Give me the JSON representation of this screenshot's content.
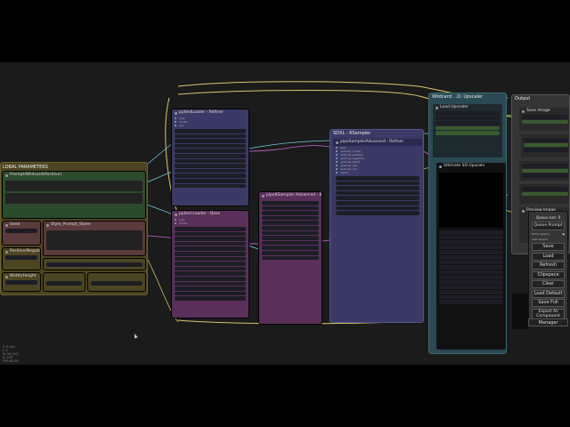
{
  "groups": {
    "global": {
      "title": "LOBAL PARAMETERS"
    },
    "sdxl": {
      "title": "SDXL - KSampler"
    },
    "detailer": {
      "title": "Wildcard: ..D: Upscaler"
    },
    "output": {
      "title": "Output"
    }
  },
  "nodes": {
    "prompt_pos": {
      "title": "Prompt/Wildcard(Positive)"
    },
    "prompt_neg": {
      "title": "Prompt Negative"
    },
    "seed": {
      "title": "Seed"
    },
    "pos_neg": {
      "title": "Positive/Negative"
    },
    "width_height": {
      "title": "Width/Height"
    },
    "style": {
      "title": "Style_Prompt_Styler"
    },
    "sampler_a": {
      "title": "ppliedLoader - Refiner"
    },
    "sampler_b": {
      "title": "pplied Loader - Base"
    },
    "ksampler_main": {
      "title": "pipeSamplerAdvanced - Refiner"
    },
    "pipe_ksampler": {
      "title": "pipeKSampler Advanced - Base"
    },
    "load_upscale": {
      "title": "Load Upscaler"
    },
    "ultimate_upscale": {
      "title": "Ultimate SD Upscale"
    },
    "image_preview": {
      "title": "Preview Image"
    },
    "out_a": {
      "title": "Save Image"
    }
  },
  "menu": {
    "queue_size_label": "Queue size: 0",
    "queue_prompt": "Queue Prompt",
    "extra_options": "Extra options",
    "auto_queue": "Auto Queue",
    "buttons": {
      "save": "Save",
      "load": "Load",
      "refresh": "Refresh",
      "clipspace": "Clipspace",
      "clear": "Clear",
      "load_default": "Load Default",
      "save_full": "Save Full",
      "export_as_component": "Export As Component",
      "manager": "Manager"
    }
  },
  "stats": {
    "line1": "T: 0.00s",
    "line2": "I: 0",
    "line3": "N: 94 [94]",
    "line4": "V: 193",
    "line5": "FPS:60.98"
  },
  "colors": {
    "canvas": "#1b1b1b",
    "purple": "#3b3a66",
    "magenta": "#5a2f5a",
    "green": "#2c4a2c",
    "olive": "#4d4421",
    "teal": "#294a52",
    "wire_yellow": "#d8c96a",
    "wire_cyan": "#6ac8d8",
    "wire_green": "#8fd86a",
    "wire_pink": "#c86ad8"
  }
}
